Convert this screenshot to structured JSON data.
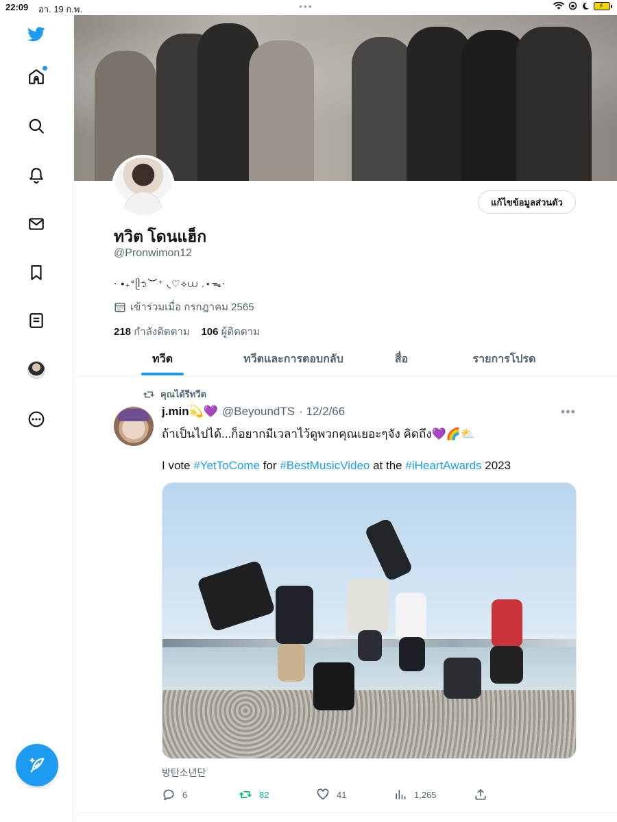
{
  "status_bar": {
    "time": "22:09",
    "date": "อา. 19 ก.พ.",
    "dots": "•••",
    "battery_label": "⚡"
  },
  "sidebar": {
    "items": [
      {
        "name": "home",
        "icon": "home-icon"
      },
      {
        "name": "explore",
        "icon": "search-icon"
      },
      {
        "name": "notifications",
        "icon": "bell-icon"
      },
      {
        "name": "messages",
        "icon": "envelope-icon"
      },
      {
        "name": "bookmarks",
        "icon": "bookmark-icon"
      },
      {
        "name": "lists",
        "icon": "list-icon"
      },
      {
        "name": "profile",
        "icon": "avatar"
      },
      {
        "name": "more",
        "icon": "more-circle-icon"
      }
    ],
    "compose_icon": "compose-icon"
  },
  "profile": {
    "display_name": "ทวิต โดนแฮ็ก",
    "handle": "@Pronwimon12",
    "bio": "⋅ •₊°ᥫ᭡︶⁺ ◟♡⟡⩊ .⋆ᯓ⋅",
    "joined": "เข้าร่วมเมื่อ กรกฎาคม 2565",
    "following_count": "218",
    "following_label": "กำลังติดตาม",
    "followers_count": "106",
    "followers_label": "ผู้ติดตาม",
    "edit_button": "แก้ไขข้อมูลส่วนตัว"
  },
  "tabs": [
    {
      "label": "ทวีต",
      "active": true
    },
    {
      "label": "ทวีตและการตอบกลับ",
      "active": false
    },
    {
      "label": "สื่อ",
      "active": false
    },
    {
      "label": "รายการโปรด",
      "active": false
    }
  ],
  "tweet": {
    "retweet_note": "คุณได้รีทวีต",
    "author_name": "j.min💫💜",
    "author_handle": "@BeyoundTS",
    "date": "· 12/2/66",
    "line1": "ถ้าเป็นไปได้...ก็อยากมีเวลาไว้ดูพวกคุณเยอะๆจัง คิดถึง💜🌈⛅",
    "line2": {
      "t1": "I vote ",
      "tag1": "#YetToCome",
      "t2": " for ",
      "tag2": "#BestMusicVideo",
      "t3": " at the ",
      "tag3": "#iHeartAwards",
      "t4": " 2023"
    },
    "photo_caption": "방탄소년단",
    "actions": {
      "replies": "6",
      "retweets": "82",
      "likes": "41",
      "views": "1,265"
    }
  },
  "colors": {
    "accent": "#1d9bf0",
    "retweet": "#00ba7c",
    "secondary_text": "#536471"
  }
}
